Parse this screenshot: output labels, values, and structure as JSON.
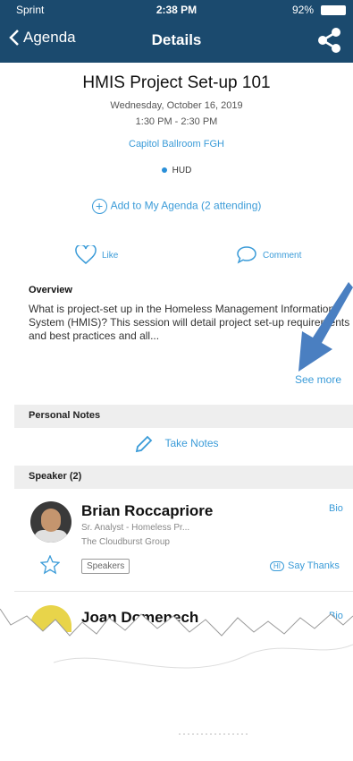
{
  "status_bar": {
    "carrier": "Sprint",
    "time": "2:38 PM",
    "battery": "92%"
  },
  "nav": {
    "back_label": "Agenda",
    "title": "Details"
  },
  "session": {
    "title": "HMIS Project Set-up 101",
    "date": "Wednesday, October 16, 2019",
    "time": "1:30 PM - 2:30 PM",
    "room": "Capitol Ballroom FGH",
    "track": "HUD",
    "track_color": "#2a8fd8",
    "add_agenda_label": "Add to My Agenda (2 attending)"
  },
  "actions": {
    "like_label": "Like",
    "comment_label": "Comment"
  },
  "overview": {
    "heading": "Overview",
    "text": "What is project-set up in the Homeless Management Information System (HMIS)? This session will detail project set-up requirements and best practices and all...",
    "see_more_label": "See more"
  },
  "personal_notes": {
    "heading": "Personal Notes",
    "take_notes_label": "Take Notes"
  },
  "speakers": {
    "heading": "Speaker (2)",
    "items": [
      {
        "name": "Brian Roccapriore",
        "role": "Sr. Analyst - Homeless Pr...",
        "org": "The Cloudburst Group",
        "bio_label": "Bio",
        "tag": "Speakers",
        "say_thanks_label": "Say Thanks"
      },
      {
        "name": "Joan Domenech",
        "bio_label": "Bio"
      }
    ]
  },
  "colors": {
    "nav_bar": "#1b4a6e",
    "accent": "#3a9bd8"
  }
}
